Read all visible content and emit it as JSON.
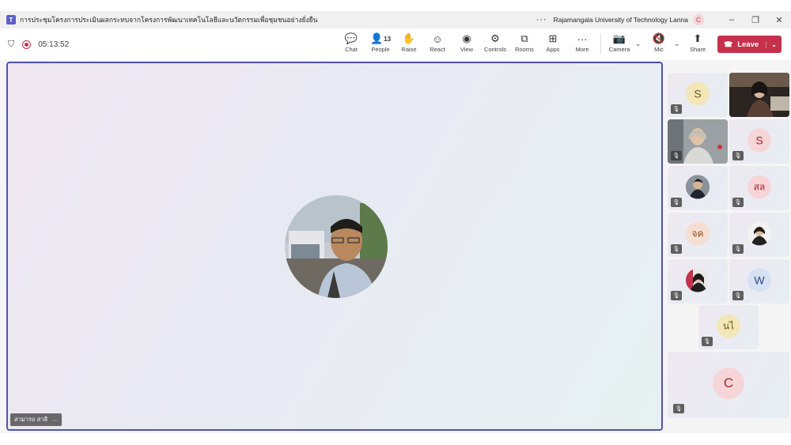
{
  "window": {
    "title": "การประชุมโครงการประเมินผลกระทบจากโครงการพัฒนาเทคโนโลยีและนวัตกรรมเพื่อชุมชนอย่างยั่งยืน",
    "more_icon": "···",
    "org": "Rajamangala University of Technology Lanna",
    "user_initial": "C",
    "minimize": "–",
    "restore": "❐",
    "close": "✕"
  },
  "toolbar": {
    "timer": "05:13:52",
    "people_count": "13",
    "buttons": [
      {
        "label": "Chat",
        "icon": "chat-icon"
      },
      {
        "label": "People",
        "icon": "people-icon"
      },
      {
        "label": "Raise",
        "icon": "hand-icon"
      },
      {
        "label": "React",
        "icon": "smile-icon"
      },
      {
        "label": "View",
        "icon": "view-icon"
      },
      {
        "label": "Controls",
        "icon": "controls-icon"
      },
      {
        "label": "Rooms",
        "icon": "rooms-icon"
      },
      {
        "label": "Apps",
        "icon": "apps-icon"
      },
      {
        "label": "More",
        "icon": "more-icon"
      },
      {
        "label": "Camera",
        "icon": "camera-off-icon"
      },
      {
        "label": "Mic",
        "icon": "mic-off-icon"
      },
      {
        "label": "Share",
        "icon": "share-icon"
      }
    ],
    "leave_label": "Leave"
  },
  "main_speaker": {
    "name": "สามารถ สาลี",
    "more": "···"
  },
  "participants": [
    {
      "initials": "S",
      "type": "initial",
      "color": "#f3e6b8",
      "text_color": "#6b5a14"
    },
    {
      "initials": "",
      "type": "video"
    },
    {
      "initials": "",
      "type": "video"
    },
    {
      "initials": "S",
      "type": "initial",
      "color": "#f6d5d8",
      "text_color": "#a4262c"
    },
    {
      "initials": "",
      "type": "photo"
    },
    {
      "initials": "สล",
      "type": "initial",
      "color": "#f6d5d8",
      "text_color": "#a4262c"
    },
    {
      "initials": "จค",
      "type": "initial",
      "color": "#f6dfd2",
      "text_color": "#8a4a20"
    },
    {
      "initials": "",
      "type": "photo"
    },
    {
      "initials": "",
      "type": "photo"
    },
    {
      "initials": "W",
      "type": "initial",
      "color": "#d8e1f3",
      "text_color": "#2b4a8a"
    },
    {
      "initials": "นไ",
      "type": "initial",
      "color": "#f3e6b8",
      "text_color": "#6b5a14"
    },
    {
      "initials": "C",
      "type": "initial",
      "color": "#f6d5d8",
      "text_color": "#a4262c"
    }
  ]
}
